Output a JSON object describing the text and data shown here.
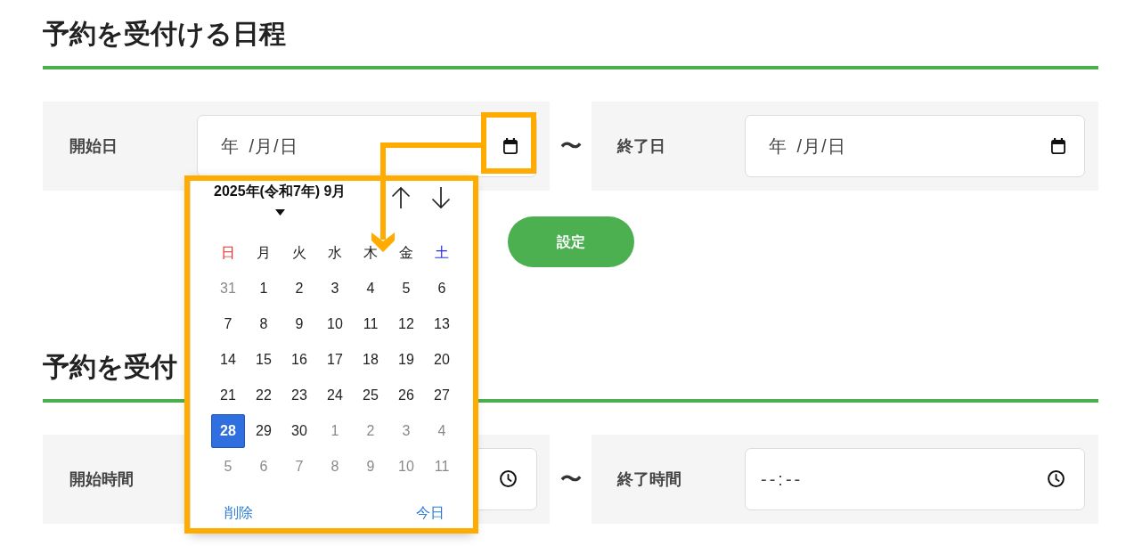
{
  "sections": [
    {
      "title": "予約を受付ける日程",
      "range": {
        "start": {
          "label": "開始日",
          "kind": "date",
          "placeholder": "年 /月/日",
          "picker": {
            "month_label": "2025年(令和7年) 9月",
            "weekdays": [
              {
                "label": "日",
                "color": "#e8302a"
              },
              {
                "label": "月",
                "color": "#222222"
              },
              {
                "label": "火",
                "color": "#222222"
              },
              {
                "label": "水",
                "color": "#222222"
              },
              {
                "label": "木",
                "color": "#222222"
              },
              {
                "label": "金",
                "color": "#222222"
              },
              {
                "label": "土",
                "color": "#2b2bf0"
              }
            ],
            "weeks": [
              [
                {
                  "label": "31",
                  "in_month": false,
                  "selected": false
                },
                {
                  "label": "1",
                  "in_month": true,
                  "selected": false
                },
                {
                  "label": "2",
                  "in_month": true,
                  "selected": false
                },
                {
                  "label": "3",
                  "in_month": true,
                  "selected": false
                },
                {
                  "label": "4",
                  "in_month": true,
                  "selected": false
                },
                {
                  "label": "5",
                  "in_month": true,
                  "selected": false
                },
                {
                  "label": "6",
                  "in_month": true,
                  "selected": false
                }
              ],
              [
                {
                  "label": "7",
                  "in_month": true,
                  "selected": false
                },
                {
                  "label": "8",
                  "in_month": true,
                  "selected": false
                },
                {
                  "label": "9",
                  "in_month": true,
                  "selected": false
                },
                {
                  "label": "10",
                  "in_month": true,
                  "selected": false
                },
                {
                  "label": "11",
                  "in_month": true,
                  "selected": false
                },
                {
                  "label": "12",
                  "in_month": true,
                  "selected": false
                },
                {
                  "label": "13",
                  "in_month": true,
                  "selected": false
                }
              ],
              [
                {
                  "label": "14",
                  "in_month": true,
                  "selected": false
                },
                {
                  "label": "15",
                  "in_month": true,
                  "selected": false
                },
                {
                  "label": "16",
                  "in_month": true,
                  "selected": false
                },
                {
                  "label": "17",
                  "in_month": true,
                  "selected": false
                },
                {
                  "label": "18",
                  "in_month": true,
                  "selected": false
                },
                {
                  "label": "19",
                  "in_month": true,
                  "selected": false
                },
                {
                  "label": "20",
                  "in_month": true,
                  "selected": false
                }
              ],
              [
                {
                  "label": "21",
                  "in_month": true,
                  "selected": false
                },
                {
                  "label": "22",
                  "in_month": true,
                  "selected": false
                },
                {
                  "label": "23",
                  "in_month": true,
                  "selected": false
                },
                {
                  "label": "24",
                  "in_month": true,
                  "selected": false
                },
                {
                  "label": "25",
                  "in_month": true,
                  "selected": false
                },
                {
                  "label": "26",
                  "in_month": true,
                  "selected": false
                },
                {
                  "label": "27",
                  "in_month": true,
                  "selected": false
                }
              ],
              [
                {
                  "label": "28",
                  "in_month": true,
                  "selected": true
                },
                {
                  "label": "29",
                  "in_month": true,
                  "selected": false
                },
                {
                  "label": "30",
                  "in_month": true,
                  "selected": false
                },
                {
                  "label": "1",
                  "in_month": false,
                  "selected": false
                },
                {
                  "label": "2",
                  "in_month": false,
                  "selected": false
                },
                {
                  "label": "3",
                  "in_month": false,
                  "selected": false
                },
                {
                  "label": "4",
                  "in_month": false,
                  "selected": false
                }
              ],
              [
                {
                  "label": "5",
                  "in_month": false,
                  "selected": false
                },
                {
                  "label": "6",
                  "in_month": false,
                  "selected": false
                },
                {
                  "label": "7",
                  "in_month": false,
                  "selected": false
                },
                {
                  "label": "8",
                  "in_month": false,
                  "selected": false
                },
                {
                  "label": "9",
                  "in_month": false,
                  "selected": false
                },
                {
                  "label": "10",
                  "in_month": false,
                  "selected": false
                },
                {
                  "label": "11",
                  "in_month": false,
                  "selected": false
                }
              ]
            ],
            "clear_label": "削除",
            "today_label": "今日"
          }
        },
        "separator": "〜",
        "end": {
          "label": "終了日",
          "kind": "date",
          "placeholder": "年 /月/日"
        }
      },
      "button": {
        "label": "設定"
      }
    },
    {
      "title": "予約を受付",
      "range": {
        "start": {
          "label": "開始時間",
          "kind": "time"
        },
        "separator": "〜",
        "end": {
          "label": "終了時間",
          "kind": "time",
          "placeholder": "--:--"
        }
      }
    }
  ],
  "annotations": {
    "button_frame": true,
    "picker_frame": true,
    "arrow": true
  }
}
